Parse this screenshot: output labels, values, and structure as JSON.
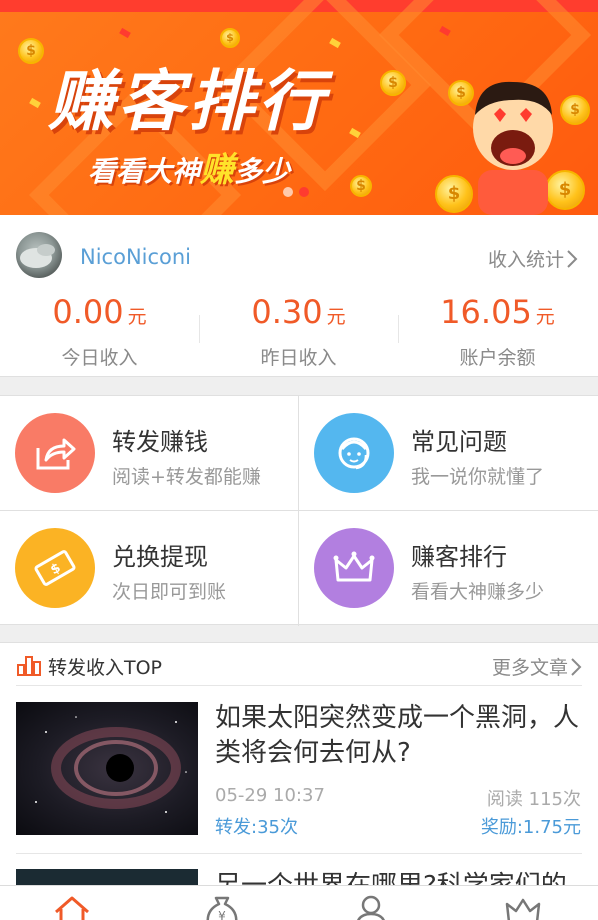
{
  "banner": {
    "title": "赚客排行",
    "subtitle_prefix": "看看大神",
    "subtitle_highlight": "赚",
    "subtitle_suffix": "多少",
    "coin_symbol": "$",
    "colors": {
      "background": "#ff6a12",
      "accent": "#ffe22a"
    }
  },
  "profile": {
    "username": "NicoNiconi",
    "income_stats_label": "收入统计",
    "stats": [
      {
        "value": "0.00",
        "unit": "元",
        "label": "今日收入"
      },
      {
        "value": "0.30",
        "unit": "元",
        "label": "昨日收入"
      },
      {
        "value": "16.05",
        "unit": "元",
        "label": "账户余额"
      }
    ]
  },
  "features": [
    {
      "title": "转发赚钱",
      "subtitle": "阅读+转发都能赚",
      "icon": "share-icon",
      "color": "#f97b66"
    },
    {
      "title": "常见问题",
      "subtitle": "我一说你就懂了",
      "icon": "support-agent-icon",
      "color": "#54b7ef"
    },
    {
      "title": "兑换提现",
      "subtitle": "次日即可到账",
      "icon": "banknote-icon",
      "color": "#fbb324"
    },
    {
      "title": "赚客排行",
      "subtitle": "看看大神赚多少",
      "icon": "crown-icon",
      "color": "#b27fe0"
    }
  ],
  "top_section": {
    "title": "转发收入TOP",
    "more_label": "更多文章",
    "articles": [
      {
        "title": "如果太阳突然变成一个黑洞，人类将会何去何从?",
        "time": "05-29 10:37",
        "reads": "阅读 115次",
        "shares": "转发:35次",
        "reward": "奖励:1.75元"
      },
      {
        "title": "另一个世界在哪里?科学家们的"
      }
    ]
  },
  "tabbar": {
    "tabs": [
      {
        "icon": "home-icon",
        "active": true
      },
      {
        "icon": "money-bag-icon",
        "active": false
      },
      {
        "icon": "user-icon",
        "active": false
      },
      {
        "icon": "crown-icon",
        "active": false
      }
    ],
    "active_color": "#f05a28"
  }
}
